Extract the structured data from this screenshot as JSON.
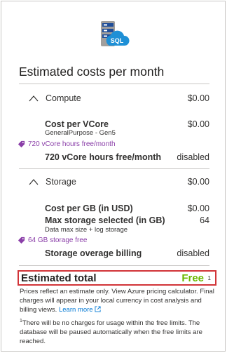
{
  "title": "Estimated costs per month",
  "compute": {
    "label": "Compute",
    "value": "$0.00",
    "cost_per_vcore_label": "Cost per VCore",
    "cost_per_vcore_value": "$0.00",
    "tier": "GeneralPurpose - Gen5",
    "free_tag": "720 vCore hours free/month",
    "free_hours_label": "720 vCore hours free/month",
    "free_hours_value": "disabled"
  },
  "storage": {
    "label": "Storage",
    "value": "$0.00",
    "cost_per_gb_label": "Cost per GB (in USD)",
    "cost_per_gb_value": "$0.00",
    "max_storage_label": "Max storage selected (in GB)",
    "max_storage_value": "64",
    "max_storage_note": "Data max size + log storage",
    "free_tag": "64 GB storage free",
    "overage_label": "Storage overage billing",
    "overage_value": "disabled"
  },
  "total": {
    "label": "Estimated total",
    "value": "Free",
    "footnote_mark": "1"
  },
  "footer": {
    "note_part1": "Prices reflect an estimate only. View Azure pricing calculator. Final charges will appear in your local currency in cost analysis and billing views.",
    "learn_more": "Learn more",
    "footnote_mark": "1",
    "footnote_text": "There will be no charges for usage within the free limits. The database will be paused automatically when the free limits are reached."
  },
  "logo_text": "SQL",
  "colors": {
    "accent_free": "#6bb700",
    "highlight_border": "#d13438",
    "tag_purple": "#8a3ea8",
    "link_blue": "#0078d4"
  },
  "icons": {
    "logo": "sql-database-icon",
    "section_toggle": "chevron-up-icon",
    "tag": "tag-icon",
    "external": "external-link-icon"
  }
}
